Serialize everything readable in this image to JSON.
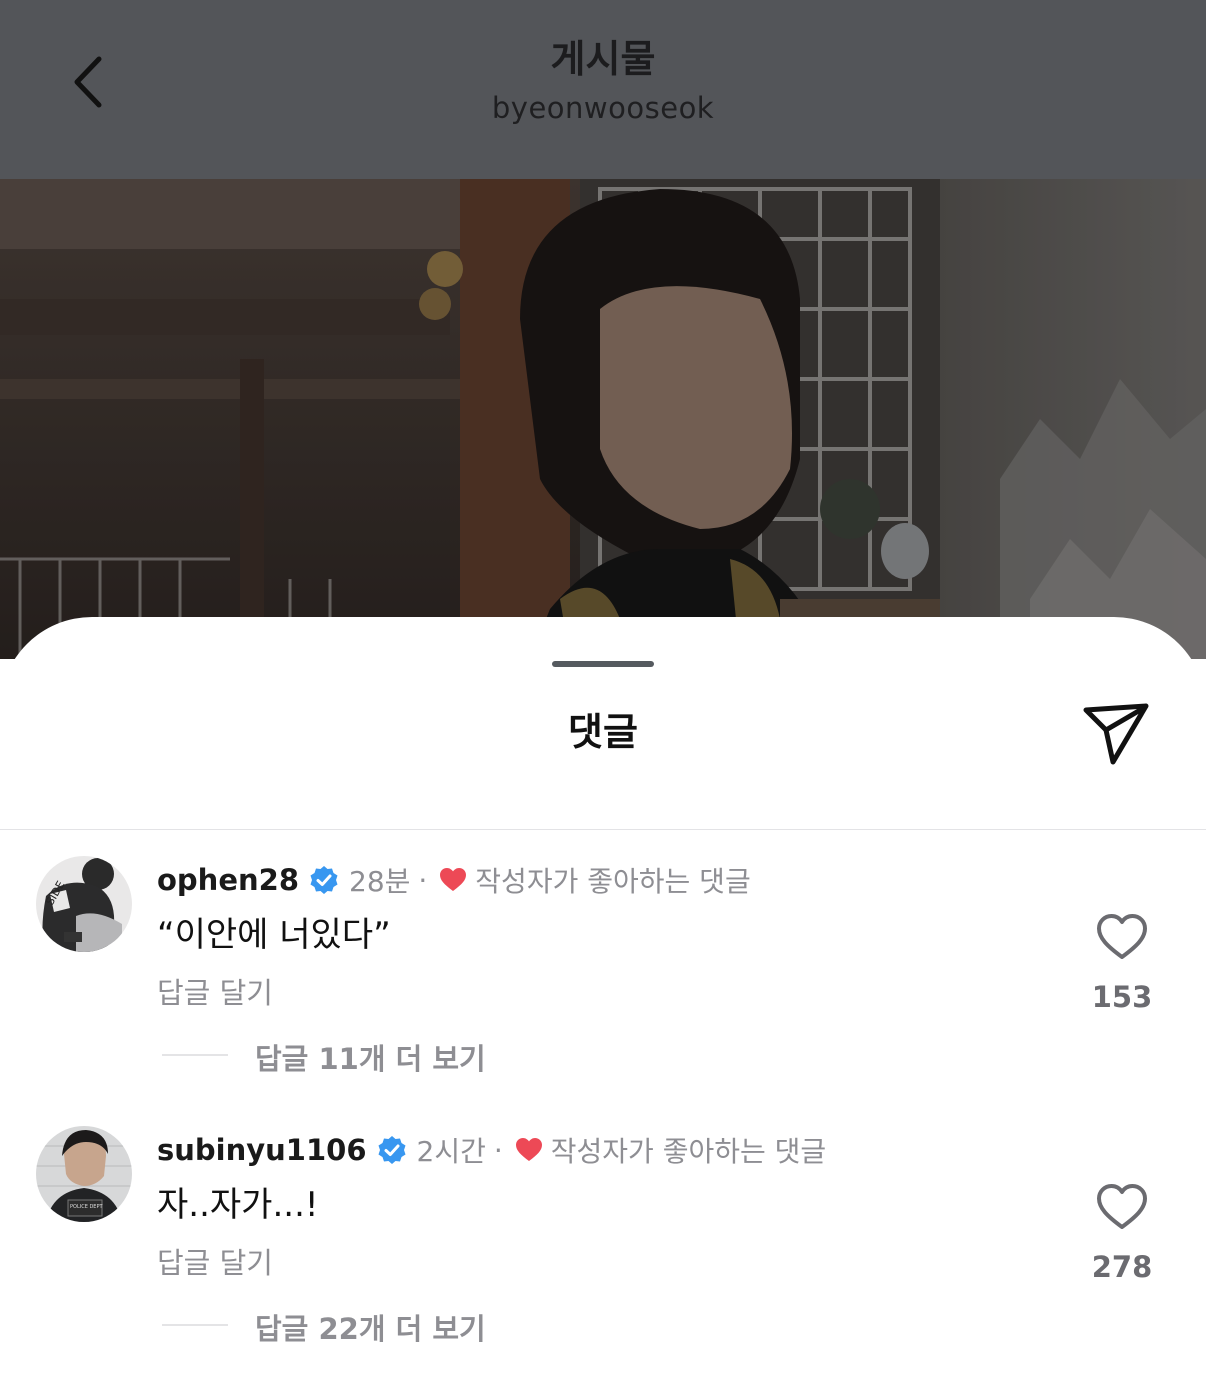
{
  "header": {
    "title": "게시물",
    "subtitle": "byeonwooseok",
    "back_icon": "chevron-left-icon"
  },
  "sheet": {
    "title": "댓글",
    "share_icon": "paper-plane-icon"
  },
  "comments": [
    {
      "username": "ophen28",
      "verified": true,
      "time": "28분",
      "separator": "·",
      "liked_by_author_label": "작성자가 좋아하는 댓글",
      "text": "“이안에 너있다”",
      "reply_label": "답글 달기",
      "view_replies_label": "답글 11개 더 보기",
      "likes": "153"
    },
    {
      "username": "subinyu1106",
      "verified": true,
      "time": "2시간",
      "separator": "·",
      "liked_by_author_label": "작성자가 좋아하는 댓글",
      "text": "자..자가...!",
      "reply_label": "답글 달기",
      "view_replies_label": "답글 22개 더 보기",
      "likes": "278"
    }
  ],
  "colors": {
    "verified_blue": "#3897f0",
    "heart_red": "#ed4956",
    "muted_text": "#8e8e93",
    "dim_overlay": "#535559"
  }
}
